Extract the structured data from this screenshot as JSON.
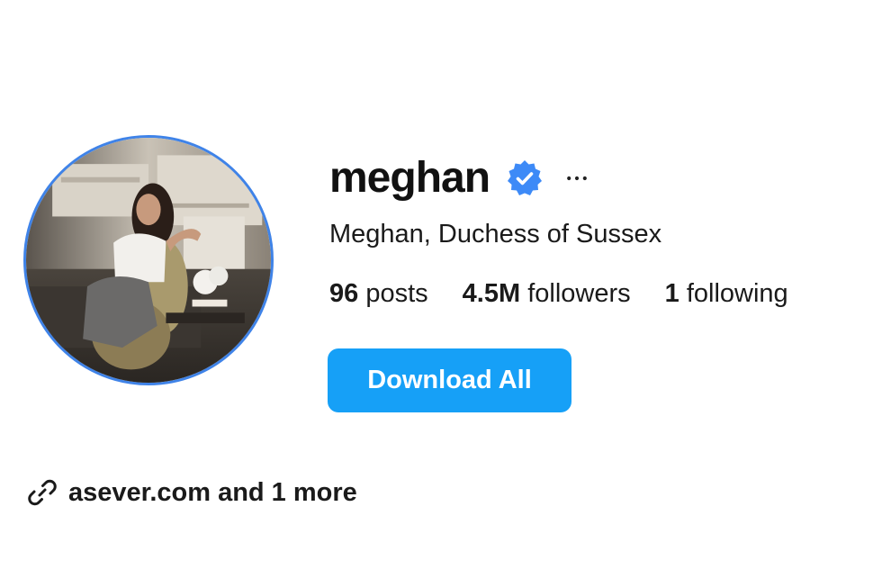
{
  "profile": {
    "username": "meghan",
    "full_name": "Meghan, Duchess of Sussex",
    "verified": true,
    "more_icon": "more-horizontal-icon",
    "avatar_ring_color": "#3f83e8"
  },
  "stats": {
    "posts_count": "96",
    "posts_label": "posts",
    "followers_count": "4.5M",
    "followers_label": "followers",
    "following_count": "1",
    "following_label": "following"
  },
  "actions": {
    "download_label": "Download All",
    "download_color": "#16a0f7"
  },
  "links": {
    "icon": "link-icon",
    "text": "asever.com and 1 more"
  },
  "colors": {
    "verified_badge": "#3d8af7"
  }
}
